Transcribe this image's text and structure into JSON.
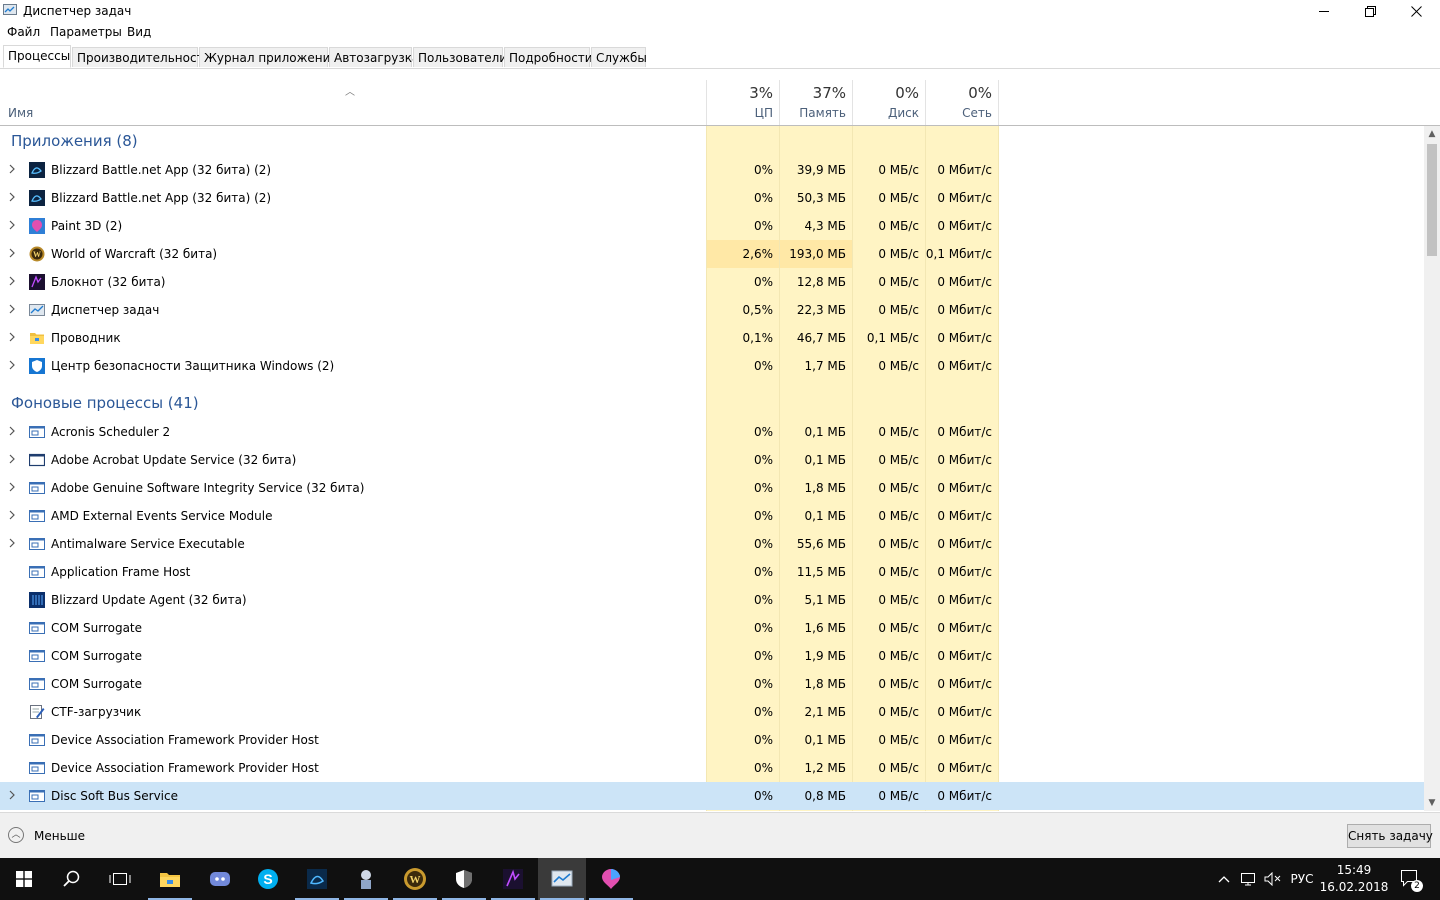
{
  "window": {
    "title": "Диспетчер задач",
    "controls": {
      "minimize": "—",
      "maximize": "❐",
      "close": "✕"
    }
  },
  "menu": [
    "Файл",
    "Параметры",
    "Вид"
  ],
  "tabs": [
    "Процессы",
    "Производительность",
    "Журнал приложений",
    "Автозагрузка",
    "Пользователи",
    "Подробности",
    "Службы"
  ],
  "active_tab": 0,
  "columns": {
    "name": "Имя",
    "cpu": {
      "pct": "3%",
      "label": "ЦП"
    },
    "memory": {
      "pct": "37%",
      "label": "Память"
    },
    "disk": {
      "pct": "0%",
      "label": "Диск"
    },
    "network": {
      "pct": "0%",
      "label": "Сеть"
    }
  },
  "groups": {
    "apps": "Приложения (8)",
    "background": "Фоновые процессы (41)"
  },
  "apps": [
    {
      "name": "Blizzard Battle.net App (32 бита) (2)",
      "icon": "battlenet-icon",
      "cpu": "0%",
      "mem": "39,9 МБ",
      "disk": "0 МБ/с",
      "net": "0 Мбит/с",
      "expand": true
    },
    {
      "name": "Blizzard Battle.net App (32 бита) (2)",
      "icon": "battlenet-icon",
      "cpu": "0%",
      "mem": "50,3 МБ",
      "disk": "0 МБ/с",
      "net": "0 Мбит/с",
      "expand": true
    },
    {
      "name": "Paint 3D (2)",
      "icon": "paint3d-icon",
      "cpu": "0%",
      "mem": "4,3 МБ",
      "disk": "0 МБ/с",
      "net": "0 Мбит/с",
      "expand": true
    },
    {
      "name": "World of Warcraft (32 бита)",
      "icon": "wow-icon",
      "cpu": "2,6%",
      "mem": "193,0 МБ",
      "disk": "0 МБ/с",
      "net": "0,1 Мбит/с",
      "expand": true,
      "hl_cpu": true,
      "hl_mem": true
    },
    {
      "name": "Блокнот (32 бита)",
      "icon": "notepad-icon",
      "cpu": "0%",
      "mem": "12,8 МБ",
      "disk": "0 МБ/с",
      "net": "0 Мбит/с",
      "expand": true
    },
    {
      "name": "Диспетчер задач",
      "icon": "task-manager-icon",
      "cpu": "0,5%",
      "mem": "22,3 МБ",
      "disk": "0 МБ/с",
      "net": "0 Мбит/с",
      "expand": true
    },
    {
      "name": "Проводник",
      "icon": "explorer-folder-icon",
      "cpu": "0,1%",
      "mem": "46,7 МБ",
      "disk": "0,1 МБ/с",
      "net": "0 Мбит/с",
      "expand": true
    },
    {
      "name": "Центр безопасности Защитника Windows (2)",
      "icon": "defender-shield-icon",
      "cpu": "0%",
      "mem": "1,7 МБ",
      "disk": "0 МБ/с",
      "net": "0 Мбит/с",
      "expand": true
    }
  ],
  "background": [
    {
      "name": "Acronis Scheduler 2",
      "icon": "service-window-icon",
      "cpu": "0%",
      "mem": "0,1 МБ",
      "disk": "0 МБ/с",
      "net": "0 Мбит/с",
      "expand": true
    },
    {
      "name": "Adobe Acrobat Update Service (32 бита)",
      "icon": "blank-window-icon",
      "cpu": "0%",
      "mem": "0,1 МБ",
      "disk": "0 МБ/с",
      "net": "0 Мбит/с",
      "expand": true
    },
    {
      "name": "Adobe Genuine Software Integrity Service (32 бита)",
      "icon": "service-window-icon",
      "cpu": "0%",
      "mem": "1,8 МБ",
      "disk": "0 МБ/с",
      "net": "0 Мбит/с",
      "expand": true
    },
    {
      "name": "AMD External Events Service Module",
      "icon": "service-window-icon",
      "cpu": "0%",
      "mem": "0,1 МБ",
      "disk": "0 МБ/с",
      "net": "0 Мбит/с",
      "expand": true
    },
    {
      "name": "Antimalware Service Executable",
      "icon": "service-window-icon",
      "cpu": "0%",
      "mem": "55,6 МБ",
      "disk": "0 МБ/с",
      "net": "0 Мбит/с",
      "expand": true
    },
    {
      "name": "Application Frame Host",
      "icon": "service-window-icon",
      "cpu": "0%",
      "mem": "11,5 МБ",
      "disk": "0 МБ/с",
      "net": "0 Мбит/с",
      "expand": false
    },
    {
      "name": "Blizzard Update Agent (32 бита)",
      "icon": "blizzard-agent-icon",
      "cpu": "0%",
      "mem": "5,1 МБ",
      "disk": "0 МБ/с",
      "net": "0 Мбит/с",
      "expand": false
    },
    {
      "name": "COM Surrogate",
      "icon": "service-window-icon",
      "cpu": "0%",
      "mem": "1,6 МБ",
      "disk": "0 МБ/с",
      "net": "0 Мбит/с",
      "expand": false
    },
    {
      "name": "COM Surrogate",
      "icon": "service-window-icon",
      "cpu": "0%",
      "mem": "1,9 МБ",
      "disk": "0 МБ/с",
      "net": "0 Мбит/с",
      "expand": false
    },
    {
      "name": "COM Surrogate",
      "icon": "service-window-icon",
      "cpu": "0%",
      "mem": "1,8 МБ",
      "disk": "0 МБ/с",
      "net": "0 Мбит/с",
      "expand": false
    },
    {
      "name": "CTF-загрузчик",
      "icon": "ctf-pen-icon",
      "cpu": "0%",
      "mem": "2,1 МБ",
      "disk": "0 МБ/с",
      "net": "0 Мбит/с",
      "expand": false
    },
    {
      "name": "Device Association Framework Provider Host",
      "icon": "service-window-icon",
      "cpu": "0%",
      "mem": "0,1 МБ",
      "disk": "0 МБ/с",
      "net": "0 Мбит/с",
      "expand": false
    },
    {
      "name": "Device Association Framework Provider Host",
      "icon": "service-window-icon",
      "cpu": "0%",
      "mem": "1,2 МБ",
      "disk": "0 МБ/с",
      "net": "0 Мбит/с",
      "expand": false
    },
    {
      "name": "Disc Soft Bus Service",
      "icon": "service-window-icon",
      "cpu": "0%",
      "mem": "0,8 МБ",
      "disk": "0 МБ/с",
      "net": "0 Мбит/с",
      "expand": true,
      "selected": true
    }
  ],
  "footer": {
    "less": "Меньше",
    "end_task": "Снять задачу"
  },
  "taskbar": {
    "items": [
      "start-windows-icon",
      "search-icon",
      "task-view-icon",
      "file-explorer-icon",
      "discord-icon",
      "skype-icon",
      "battlenet-icon",
      "unknown-app-icon",
      "wow-icon",
      "defender-shield-icon",
      "notepad-icon",
      "task-manager-icon",
      "paint3d-icon"
    ],
    "language": "РУС",
    "time": "15:49",
    "date": "16.02.2018",
    "notifications": "2"
  },
  "colors": {
    "heat": "#fff4c4",
    "heat_strong": "#ffe8a6",
    "selected": "#cce4f7",
    "group": "#2b5797",
    "taskbar": "#101010"
  }
}
